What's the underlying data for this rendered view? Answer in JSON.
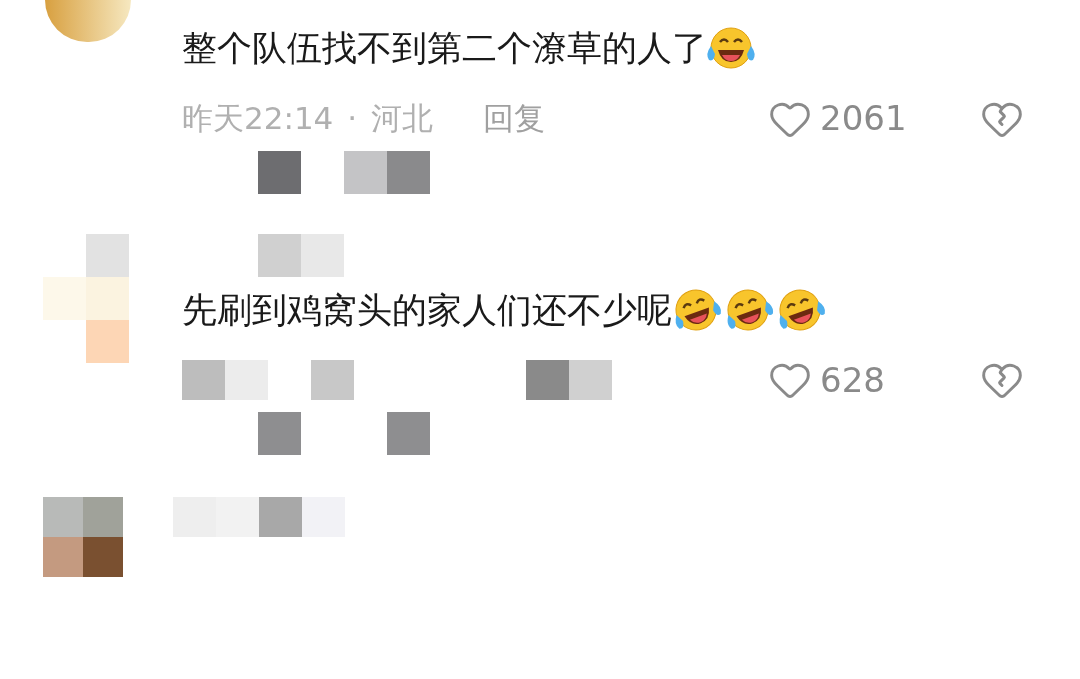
{
  "comments": [
    {
      "text": "整个队伍找不到第二个潦草的人了",
      "emojis": [
        {
          "kind": "tears_of_joy"
        }
      ],
      "time": "昨天22:14",
      "separator": "·",
      "location": "河北",
      "reply": "回复",
      "likes": "2061"
    },
    {
      "text": "先刷到鸡窝头的家人们还不少呢",
      "emojis": [
        {
          "kind": "rolling_laughing"
        },
        {
          "kind": "rolling_laughing"
        },
        {
          "kind": "rolling_laughing"
        }
      ],
      "likes": "628"
    }
  ]
}
